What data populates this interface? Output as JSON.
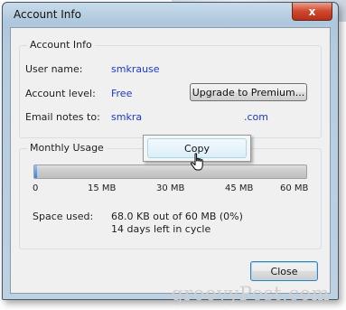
{
  "window": {
    "title": "Account Info",
    "close_glyph": "x"
  },
  "account": {
    "group_label": "Account Info",
    "username_label": "User name:",
    "username_value": "smkrause",
    "level_label": "Account level:",
    "level_value": "Free",
    "upgrade_button": "Upgrade to Premium...",
    "email_label": "Email notes to:",
    "email_value_start": "smkra",
    "email_value_end": ".com"
  },
  "usage": {
    "group_label": "Monthly Usage",
    "progress_fraction": 0.0011,
    "ticks": [
      "0",
      "15 MB",
      "30 MB",
      "45 MB",
      "60 MB"
    ],
    "space_label": "Space used:",
    "space_line1": "68.0 KB out of 60 MB (0%)",
    "space_line2": "14 days left in cycle"
  },
  "close_button": "Close",
  "context_menu": {
    "copy_label": "Copy"
  },
  "icons": {
    "cursor": "hand-pointer-icon"
  },
  "watermark": "groovyPost.com"
}
